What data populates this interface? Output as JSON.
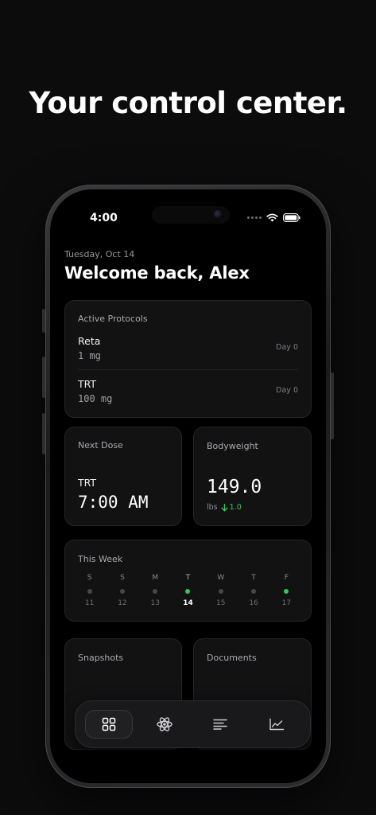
{
  "hero": {
    "title": "Your control center."
  },
  "status_bar": {
    "time": "4:00"
  },
  "header": {
    "date": "Tuesday, Oct 14",
    "greeting": "Welcome back, Alex"
  },
  "active_protocols": {
    "title": "Active Protocols",
    "items": [
      {
        "name": "Reta",
        "dose": "1 mg",
        "day": "Day 0"
      },
      {
        "name": "TRT",
        "dose": "100 mg",
        "day": "Day 0"
      }
    ]
  },
  "next_dose": {
    "title": "Next Dose",
    "compound": "TRT",
    "time": "7:00 AM"
  },
  "bodyweight": {
    "title": "Bodyweight",
    "value": "149.0",
    "unit": "lbs",
    "delta": "1.0",
    "delta_direction": "down",
    "delta_color": "#34c759"
  },
  "this_week": {
    "title": "This Week",
    "today_index": 3,
    "days": [
      {
        "letter": "S",
        "num": "11",
        "done": false
      },
      {
        "letter": "S",
        "num": "12",
        "done": false
      },
      {
        "letter": "M",
        "num": "13",
        "done": false
      },
      {
        "letter": "T",
        "num": "14",
        "done": true
      },
      {
        "letter": "W",
        "num": "15",
        "done": false
      },
      {
        "letter": "T",
        "num": "16",
        "done": false
      },
      {
        "letter": "F",
        "num": "17",
        "done": true
      }
    ]
  },
  "snapshots": {
    "title": "Snapshots"
  },
  "documents": {
    "title": "Documents"
  },
  "tab_bar": {
    "active_index": 0,
    "tabs": [
      {
        "icon": "grid-icon"
      },
      {
        "icon": "atom-icon"
      },
      {
        "icon": "list-icon"
      },
      {
        "icon": "chart-icon"
      }
    ]
  },
  "colors": {
    "background": "#0c0c0c",
    "card": "#121213",
    "accent_green": "#34c759"
  }
}
